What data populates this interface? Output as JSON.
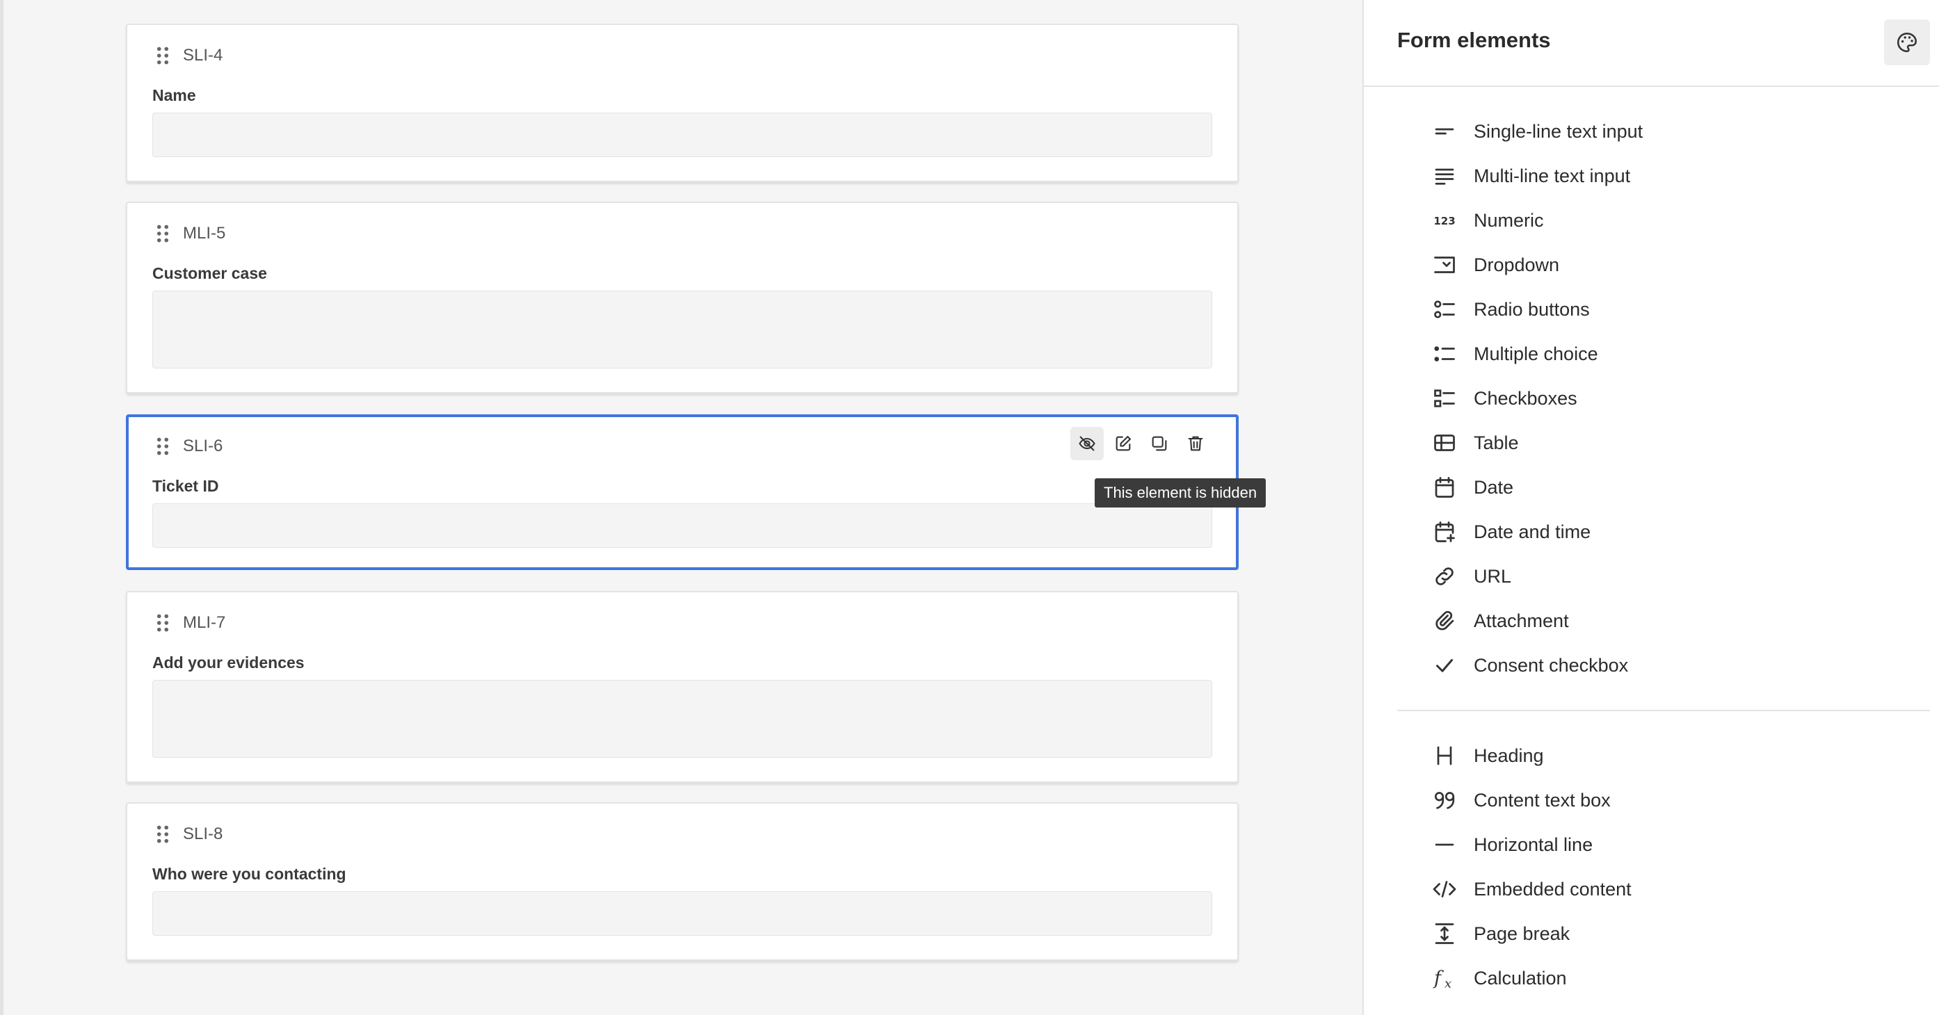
{
  "form": {
    "cards": [
      {
        "id": "SLI-4",
        "label": "Name"
      },
      {
        "id": "MLI-5",
        "label": "Customer case"
      },
      {
        "id": "SLI-6",
        "label": "Ticket ID"
      },
      {
        "id": "MLI-7",
        "label": "Add your evidences"
      },
      {
        "id": "SLI-8",
        "label": "Who were you contacting"
      }
    ],
    "selected_card": "SLI-6",
    "tooltip": "This element is hidden",
    "actions": [
      "hide",
      "edit",
      "duplicate",
      "delete"
    ]
  },
  "sidebar": {
    "title": "Form elements",
    "input_elements": [
      {
        "label": "Single-line text input",
        "icon": "single-line-icon"
      },
      {
        "label": "Multi-line text input",
        "icon": "multi-line-icon"
      },
      {
        "label": "Numeric",
        "icon": "numeric-icon"
      },
      {
        "label": "Dropdown",
        "icon": "dropdown-icon"
      },
      {
        "label": "Radio buttons",
        "icon": "radio-buttons-icon"
      },
      {
        "label": "Multiple choice",
        "icon": "multiple-choice-icon"
      },
      {
        "label": "Checkboxes",
        "icon": "checkboxes-icon"
      },
      {
        "label": "Table",
        "icon": "table-icon"
      },
      {
        "label": "Date",
        "icon": "calendar-icon"
      },
      {
        "label": "Date and time",
        "icon": "calendar-plus-icon"
      },
      {
        "label": "URL",
        "icon": "link-icon"
      },
      {
        "label": "Attachment",
        "icon": "paperclip-icon"
      },
      {
        "label": "Consent checkbox",
        "icon": "check-icon"
      }
    ],
    "content_elements": [
      {
        "label": "Heading",
        "icon": "heading-icon"
      },
      {
        "label": "Content text box",
        "icon": "quote-icon"
      },
      {
        "label": "Horizontal line",
        "icon": "horizontal-line-icon"
      },
      {
        "label": "Embedded content",
        "icon": "code-icon"
      },
      {
        "label": "Page break",
        "icon": "page-break-icon"
      },
      {
        "label": "Calculation",
        "icon": "function-icon"
      }
    ]
  }
}
